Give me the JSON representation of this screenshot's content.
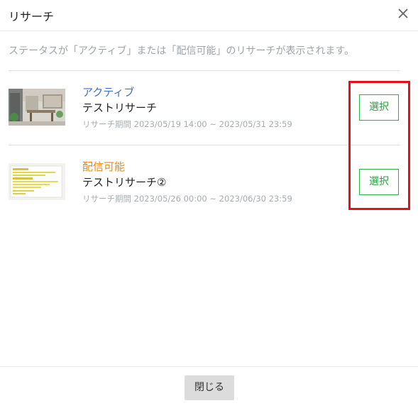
{
  "dialog": {
    "title": "リサーチ",
    "close_icon": "close-icon"
  },
  "note": "ステータスが「アクティブ」または「配信可能」のリサーチが表示されます。",
  "research_list": [
    {
      "status": "アクティブ",
      "status_color": "#3b6fd6",
      "name": "テストリサーチ",
      "period": "リサーチ期間 2023/05/19 14:00 ~ 2023/05/31 23:59",
      "select_label": "選択",
      "thumbnail": "interior-photo"
    },
    {
      "status": "配信可能",
      "status_color": "#e48a1a",
      "name": "テストリサーチ②",
      "period": "リサーチ期間 2023/05/26 00:00 ~ 2023/06/30 23:59",
      "select_label": "選択",
      "thumbnail": "document-preview"
    }
  ],
  "footer": {
    "close_label": "閉じる"
  },
  "colors": {
    "accent_green": "#2db24a",
    "highlight_red": "#e3101a"
  }
}
